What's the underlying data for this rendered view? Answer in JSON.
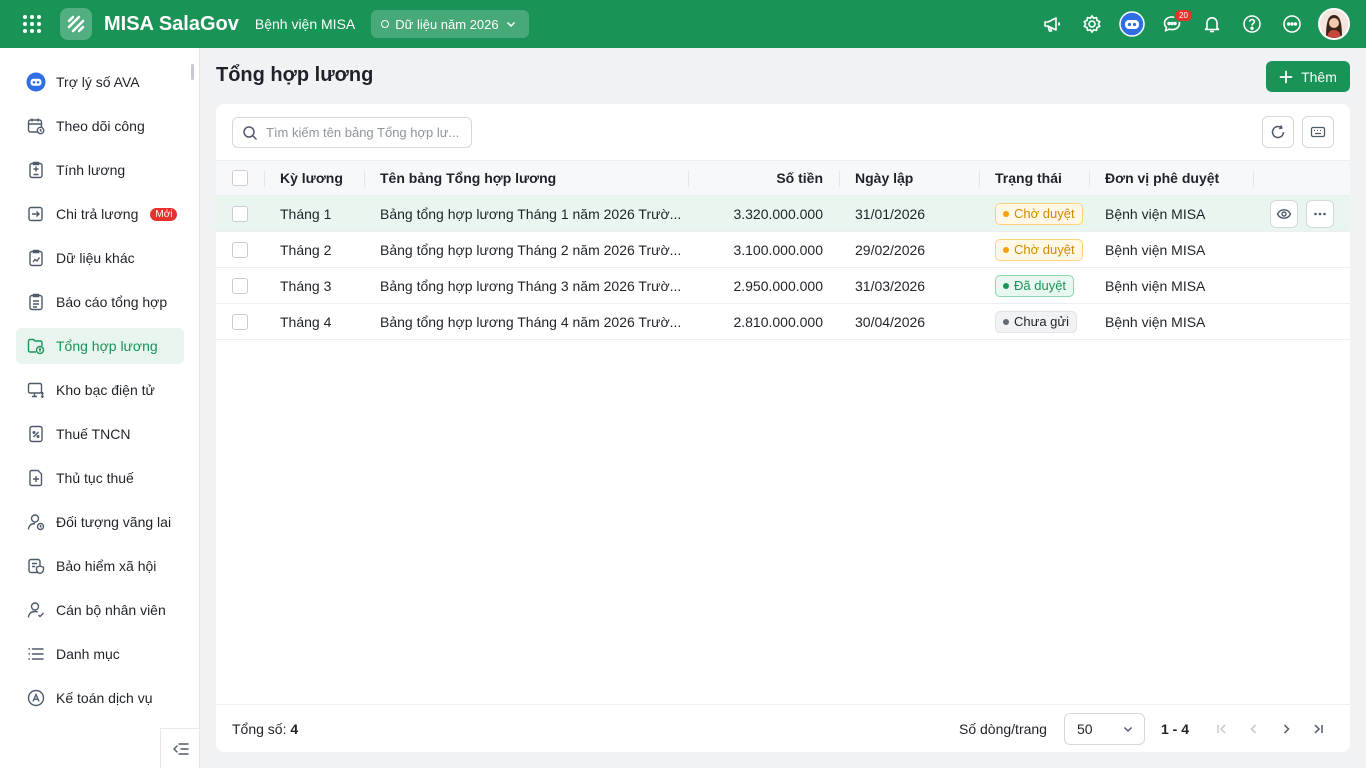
{
  "topbar": {
    "app_name": "MISA SalaGov",
    "org_name": "Bệnh viện MISA",
    "year_label": "Dữ liệu năm 2026",
    "message_count": "20",
    "brand_color": "#1a9357"
  },
  "sidebar": {
    "items": [
      {
        "label": "Trợ lý số AVA",
        "icon": "ava-bot-icon"
      },
      {
        "label": "Theo dõi công",
        "icon": "calendar-clock-icon"
      },
      {
        "label": "Tính lương",
        "icon": "calculator-doc-icon"
      },
      {
        "label": "Chi trả lương",
        "icon": "payout-icon",
        "badge": "Mới"
      },
      {
        "label": "Dữ liệu khác",
        "icon": "clipboard-data-icon"
      },
      {
        "label": "Báo cáo tổng hợp",
        "icon": "report-clipboard-icon"
      },
      {
        "label": "Tổng hợp lương",
        "icon": "folder-salary-icon",
        "active": true
      },
      {
        "label": "Kho bạc điện tử",
        "icon": "monitor-money-icon"
      },
      {
        "label": "Thuế TNCN",
        "icon": "tax-doc-icon"
      },
      {
        "label": "Thủ tục thuế",
        "icon": "doc-plus-icon"
      },
      {
        "label": "Đối tượng vãng lai",
        "icon": "user-clock-icon"
      },
      {
        "label": "Bảo hiểm xã hội",
        "icon": "insurance-icon"
      },
      {
        "label": "Cán bộ nhân viên",
        "icon": "user-check-icon"
      },
      {
        "label": "Danh mục",
        "icon": "list-icon"
      },
      {
        "label": "Kế toán dịch vụ",
        "icon": "accounting-icon"
      }
    ]
  },
  "main": {
    "title": "Tổng hợp lương",
    "add_label": "Thêm",
    "search_placeholder": "Tìm kiếm tên bảng Tổng hợp lư...",
    "columns": {
      "period": "Kỳ lương",
      "name": "Tên bảng Tổng hợp lương",
      "amount": "Số tiền",
      "date": "Ngày lập",
      "status": "Trạng thái",
      "approver": "Đơn vị phê duyệt"
    },
    "rows": [
      {
        "period": "Tháng 1",
        "name": "Bảng tổng hợp lương Tháng 1 năm 2026 Trườ...",
        "amount": "3.320.000.000",
        "date": "31/01/2026",
        "status": "Chờ duyệt",
        "status_type": "wait",
        "approver": "Bệnh viện MISA"
      },
      {
        "period": "Tháng 2",
        "name": "Bảng tổng hợp lương Tháng 2 năm 2026 Trườ...",
        "amount": "3.100.000.000",
        "date": "29/02/2026",
        "status": "Chờ duyệt",
        "status_type": "wait",
        "approver": "Bệnh viện MISA"
      },
      {
        "period": "Tháng 3",
        "name": "Bảng tổng hợp lương Tháng 3 năm 2026 Trườ...",
        "amount": "2.950.000.000",
        "date": "31/03/2026",
        "status": "Đã duyệt",
        "status_type": "ok",
        "approver": "Bệnh viện MISA"
      },
      {
        "period": "Tháng 4",
        "name": "Bảng tổng hợp lương Tháng 4 năm 2026 Trườ...",
        "amount": "2.810.000.000",
        "date": "30/04/2026",
        "status": "Chưa gửi",
        "status_type": "none",
        "approver": "Bệnh viện MISA"
      }
    ],
    "footer": {
      "total_label": "Tổng số:",
      "total_value": "4",
      "page_size_label": "Số dòng/trang",
      "page_size": "50",
      "range": "1 - 4"
    }
  }
}
